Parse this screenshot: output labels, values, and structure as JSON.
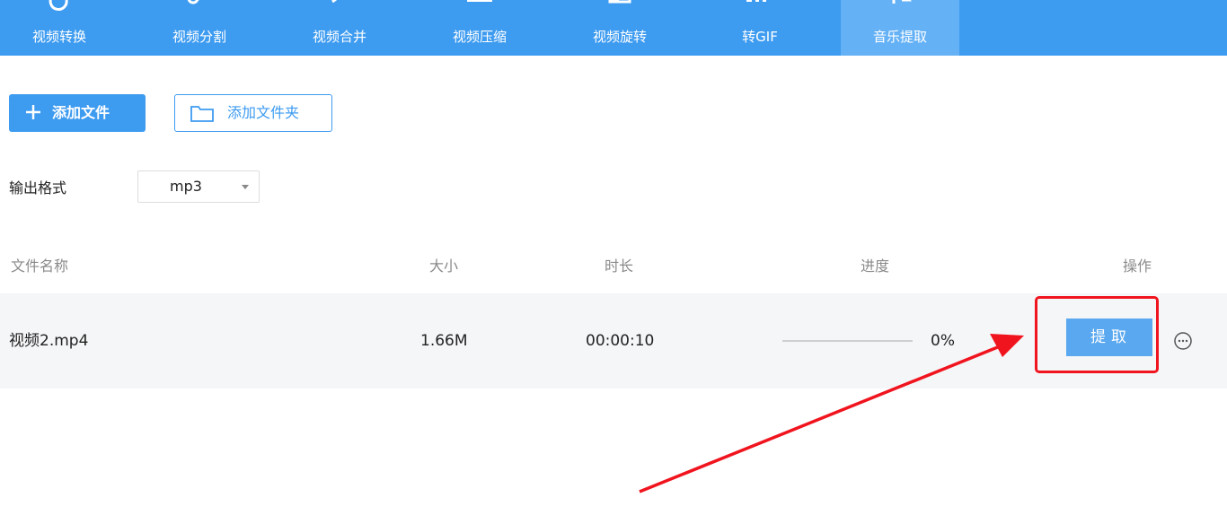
{
  "toolbar": {
    "items": [
      {
        "label": "视频转换",
        "icon": "convert-icon"
      },
      {
        "label": "视频分割",
        "icon": "scissors-icon"
      },
      {
        "label": "视频合并",
        "icon": "merge-icon"
      },
      {
        "label": "视频压缩",
        "icon": "compress-icon"
      },
      {
        "label": "视频旋转",
        "icon": "rotate-icon"
      },
      {
        "label": "转GIF",
        "icon": "gif-icon"
      },
      {
        "label": "音乐提取",
        "icon": "music-extract-icon",
        "active": true
      }
    ]
  },
  "actions": {
    "add_file": "添加文件",
    "add_folder": "添加文件夹"
  },
  "output_format": {
    "label": "输出格式",
    "selected": "mp3"
  },
  "table": {
    "headers": {
      "name": "文件名称",
      "size": "大小",
      "duration": "时长",
      "progress": "进度",
      "action": "操作"
    },
    "rows": [
      {
        "name": "视频2.mp4",
        "size": "1.66M",
        "duration": "00:00:10",
        "progress_text": "0%",
        "progress_value": 0,
        "action_label": "提取"
      }
    ]
  },
  "colors": {
    "accent": "#3d9bf0",
    "active_tab": "#64b1f6",
    "annotation": "#f0141e"
  }
}
